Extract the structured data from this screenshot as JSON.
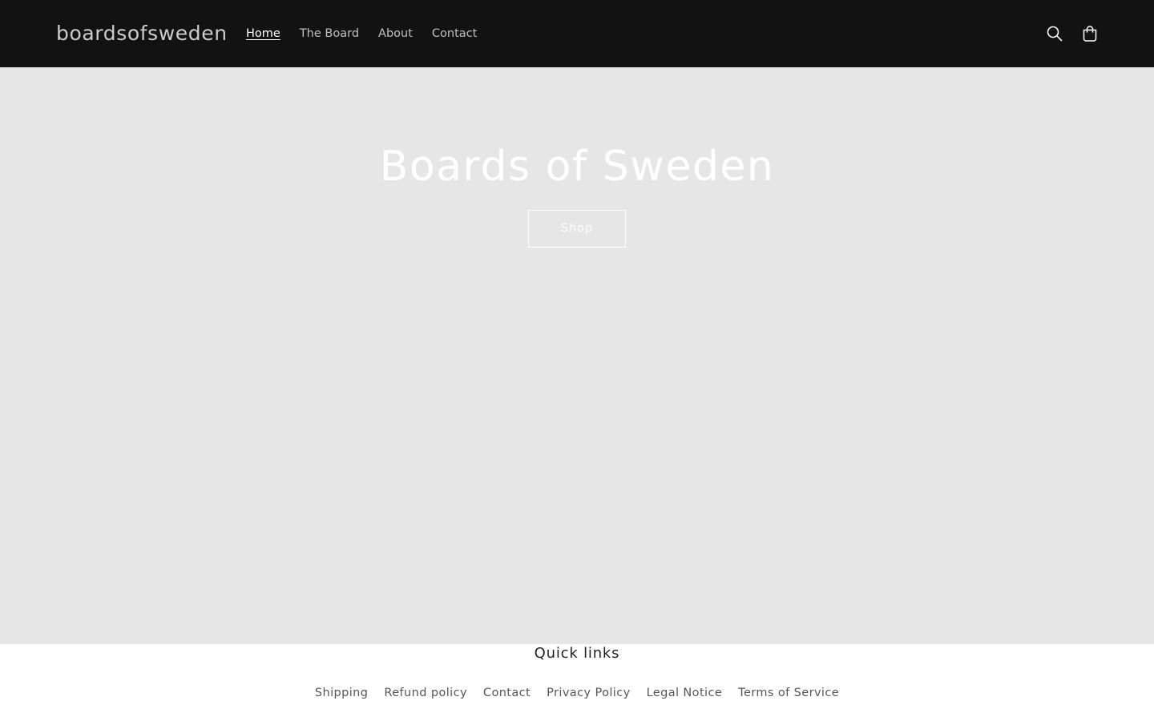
{
  "header": {
    "logo": "boardsofsweden",
    "nav": [
      {
        "label": "Home",
        "active": true
      },
      {
        "label": "The Board",
        "active": false
      },
      {
        "label": "About",
        "active": false
      },
      {
        "label": "Contact",
        "active": false
      }
    ],
    "icons": [
      "search-icon",
      "cart-icon"
    ]
  },
  "hero": {
    "title": "Boards of Sweden",
    "button_label": "Shop"
  },
  "footer": {
    "heading": "Quick links",
    "links": [
      "Shipping",
      "Refund policy",
      "Contact",
      "Privacy Policy",
      "Legal Notice",
      "Terms of Service"
    ]
  },
  "colors": {
    "header_bg": "#121212",
    "hero_bg": "#e6e6e6",
    "footer_bg": "#ffffff"
  }
}
